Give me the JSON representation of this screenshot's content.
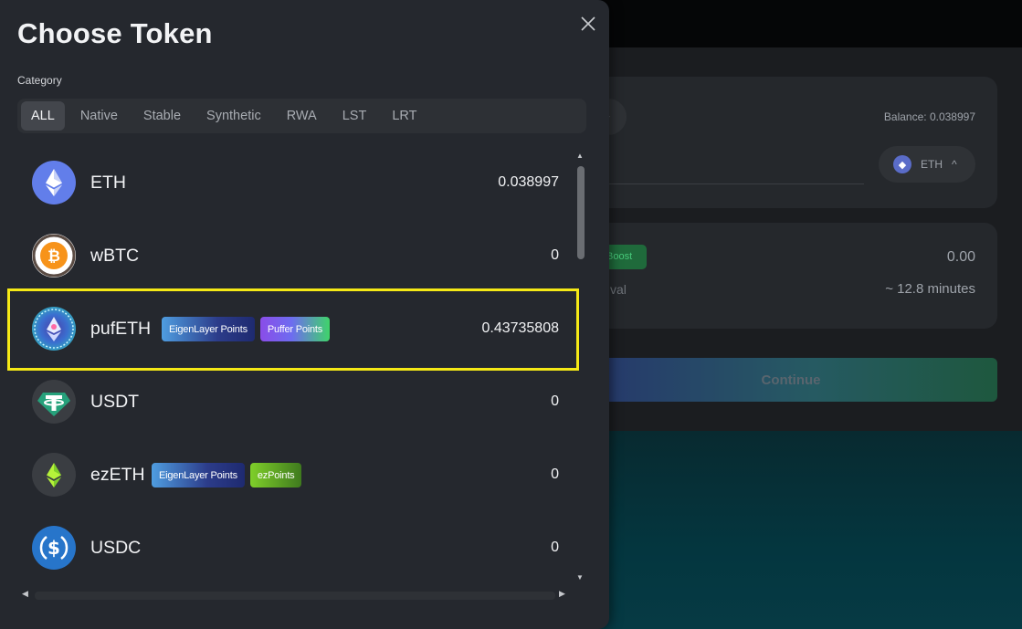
{
  "modal": {
    "title": "Choose Token",
    "category_label": "Category",
    "close_icon": "close-icon"
  },
  "tabs": [
    {
      "label": "ALL",
      "active": true
    },
    {
      "label": "Native",
      "active": false
    },
    {
      "label": "Stable",
      "active": false
    },
    {
      "label": "Synthetic",
      "active": false
    },
    {
      "label": "RWA",
      "active": false
    },
    {
      "label": "LST",
      "active": false
    },
    {
      "label": "LRT",
      "active": false
    }
  ],
  "tokens": [
    {
      "symbol": "ETH",
      "balance": "0.038997",
      "icon": "eth-icon",
      "badges": []
    },
    {
      "symbol": "wBTC",
      "balance": "0",
      "icon": "bitcoin-icon",
      "badges": []
    },
    {
      "symbol": "pufETH",
      "balance": "0.43735808",
      "icon": "pufeth-icon",
      "highlighted": true,
      "badges": [
        {
          "label": "EigenLayer Points",
          "style": "eigen"
        },
        {
          "label": "Puffer Points",
          "style": "puffer"
        }
      ]
    },
    {
      "symbol": "USDT",
      "balance": "0",
      "icon": "tether-icon",
      "badges": []
    },
    {
      "symbol": "ezETH",
      "balance": "0",
      "icon": "ezeth-icon",
      "badges": [
        {
          "label": "EigenLayer Points",
          "style": "eigen"
        },
        {
          "label": "ezPoints",
          "style": "ez"
        }
      ]
    },
    {
      "symbol": "USDC",
      "balance": "0",
      "icon": "usdc-icon",
      "badges": []
    }
  ],
  "background": {
    "balance_text": "Balance: 0.038997",
    "selected_token": "ETH",
    "boost_label": "Boost",
    "amount_value": "0.00",
    "interval_label": "val",
    "time_estimate": "~ 12.8 minutes",
    "continue_label": "Continue"
  },
  "colors": {
    "modal_bg": "#25282e",
    "highlight": "#f5e916",
    "eth_blue": "#627eea",
    "btc_orange": "#f7931a",
    "usdt_green": "#26a17b",
    "usdc_blue": "#2775ca"
  }
}
